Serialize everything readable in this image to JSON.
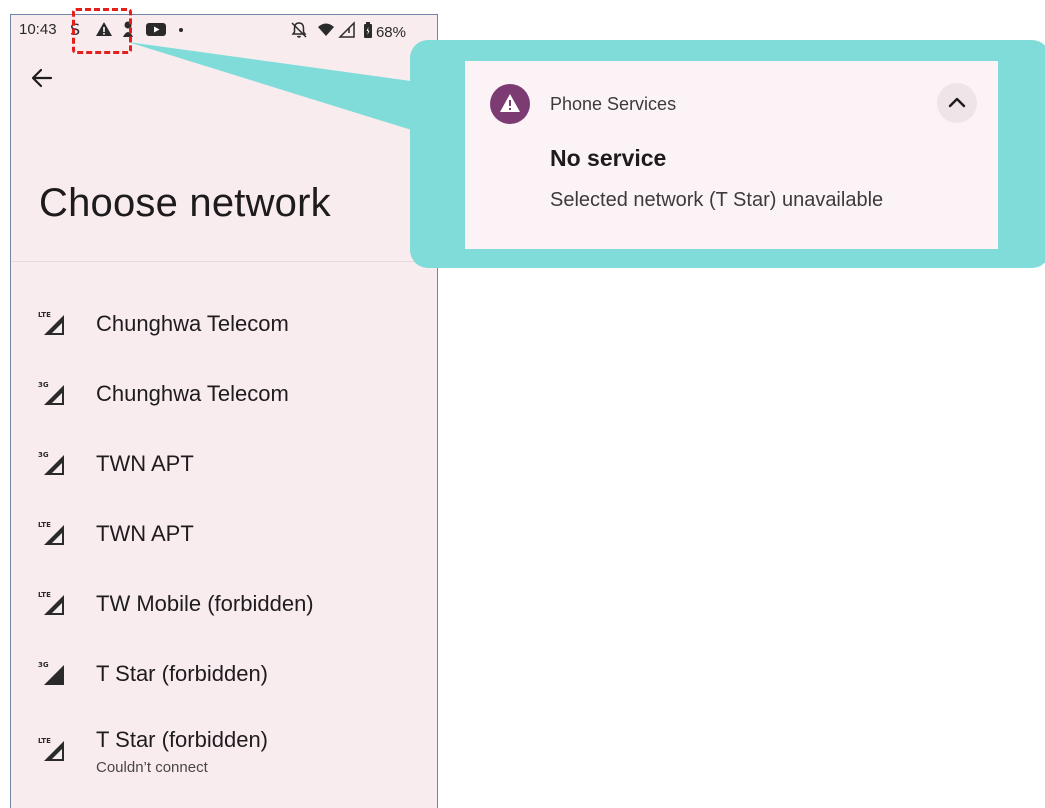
{
  "status_bar": {
    "time": "10:43",
    "battery": "68%",
    "icons": [
      "s-icon",
      "warning-icon",
      "person-icon",
      "youtube-icon",
      "dot-icon",
      "bell-off-icon",
      "wifi-icon",
      "signal-icon",
      "battery-icon"
    ]
  },
  "page": {
    "title": "Choose network"
  },
  "networks": [
    {
      "tech": "LTE",
      "label": "Chunghwa Telecom",
      "sub": ""
    },
    {
      "tech": "3G",
      "label": "Chunghwa Telecom",
      "sub": ""
    },
    {
      "tech": "3G",
      "label": "TWN APT",
      "sub": ""
    },
    {
      "tech": "LTE",
      "label": "TWN APT",
      "sub": ""
    },
    {
      "tech": "LTE",
      "label": "TW Mobile (forbidden)",
      "sub": ""
    },
    {
      "tech": "3G",
      "label": "T Star (forbidden)",
      "sub": ""
    },
    {
      "tech": "LTE",
      "label": "T Star (forbidden)",
      "sub": "Couldn’t connect"
    }
  ],
  "notification": {
    "app": "Phone Services",
    "title": "No service",
    "text": "Selected network (T Star) unavailable"
  },
  "colors": {
    "phone_bg": "#f8ecef",
    "callout": "#7fdcd9",
    "highlight": "#e3201b",
    "notif_icon": "#7d3b73"
  }
}
